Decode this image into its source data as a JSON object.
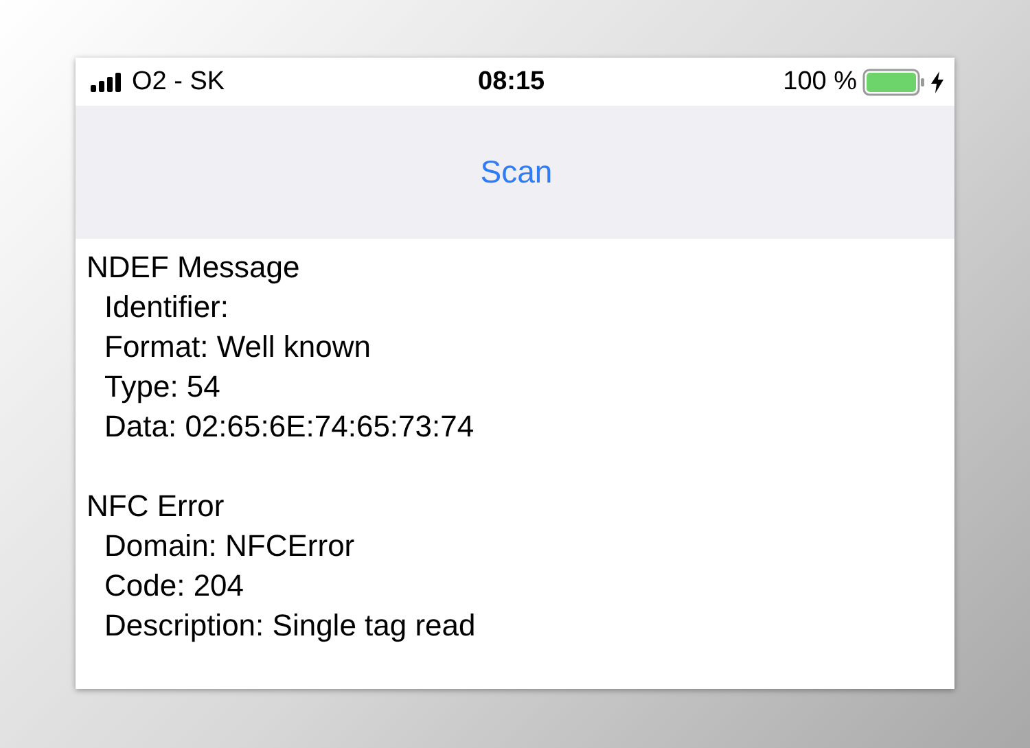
{
  "status_bar": {
    "carrier": "O2 - SK",
    "time": "08:15",
    "battery": "100 %"
  },
  "nav_bar": {
    "button": "Scan"
  },
  "sections": [
    {
      "title": "NDEF Message",
      "lines": [
        "Identifier:",
        "Format: Well known",
        "Type: 54",
        "Data: 02:65:6E:74:65:73:74"
      ]
    },
    {
      "title": "NFC Error",
      "lines": [
        "Domain: NFCError",
        "Code: 204",
        "Description: Single tag read"
      ]
    }
  ]
}
